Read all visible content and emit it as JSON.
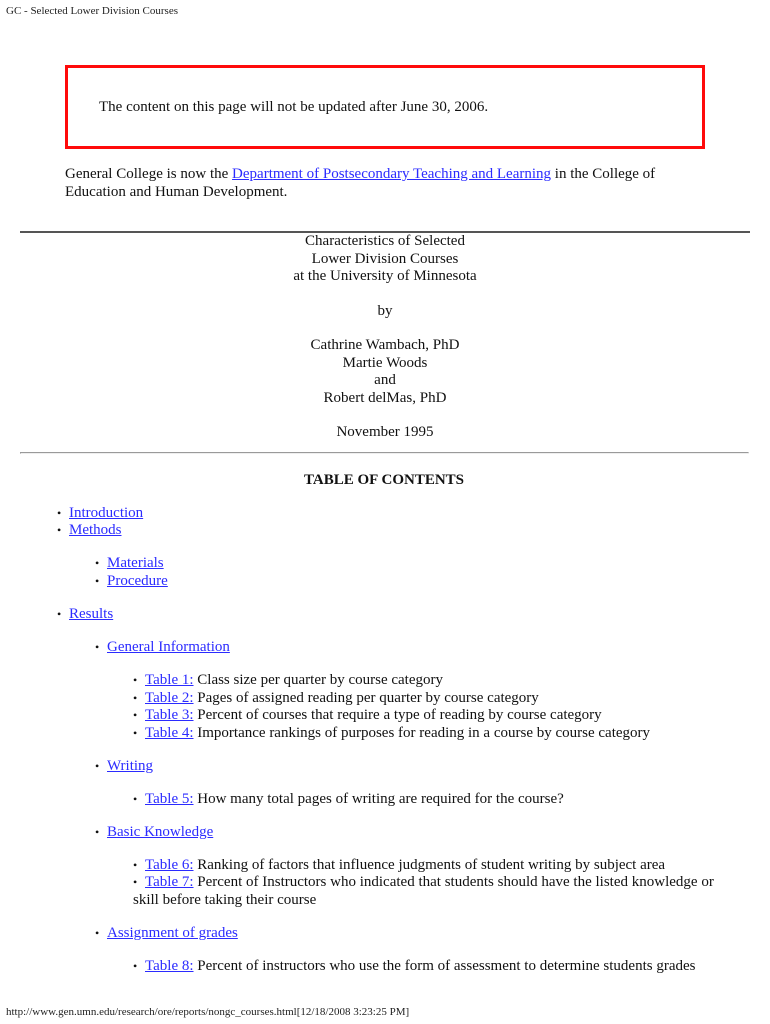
{
  "page_header": "GC - Selected Lower Division Courses",
  "notice": "The content on this page will not be updated after June 30, 2006.",
  "intro": {
    "before_link": "General College is now the ",
    "link_text": "Department of Postsecondary Teaching and Learning",
    "after_link": " in the College of Education and Human Development."
  },
  "title_block": {
    "title_lines": [
      "Characteristics of Selected",
      "Lower Division Courses",
      "at the University of Minnesota"
    ],
    "by": "by",
    "authors": [
      "Cathrine Wambach, PhD",
      "Martie Woods",
      "and",
      "Robert delMas, PhD"
    ],
    "date": "November 1995"
  },
  "toc": {
    "heading": "TABLE OF CONTENTS",
    "bullet": "•",
    "introduction": "Introduction",
    "methods": "Methods",
    "materials": "Materials",
    "procedure": "Procedure",
    "results": "Results",
    "general_information": "General Information",
    "tables": [
      {
        "link": "Table 1:",
        "text": " Class size per quarter by course category"
      },
      {
        "link": "Table 2:",
        "text": " Pages of assigned reading per quarter by course category"
      },
      {
        "link": "Table 3:",
        "text": " Percent of courses that require a type of reading by course category"
      },
      {
        "link": "Table 4:",
        "text": " Importance rankings of purposes for reading in a course by course category"
      },
      {
        "link": "Table 5:",
        "text": " How many total pages of writing are required for the course?"
      },
      {
        "link": "Table 6:",
        "text": " Ranking of factors that influence judgments of student writing by subject area"
      },
      {
        "link": "Table 7:",
        "text": " Percent of Instructors who indicated that students should have the listed knowledge or skill before taking their course"
      },
      {
        "link": "Table 8:",
        "text": " Percent of instructors who use the form of assessment to determine students grades"
      }
    ],
    "writing": "Writing",
    "basic_knowledge": "Basic Knowledge",
    "assignment_of_grades": "Assignment of grades"
  },
  "footer": "http://www.gen.umn.edu/research/ore/reports/nongc_courses.html[12/18/2008 3:23:25 PM]"
}
